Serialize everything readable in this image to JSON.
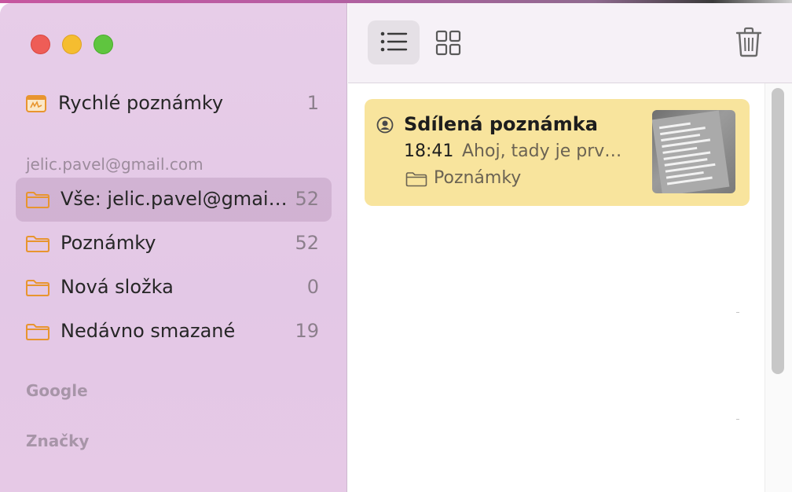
{
  "window": {
    "controls": [
      "close",
      "minimize",
      "zoom"
    ]
  },
  "sidebar": {
    "quick_notes": {
      "label": "Rychlé poznámky",
      "count": "1",
      "icon": "quick-note-icon",
      "color": "#e8952f"
    },
    "account_header": "jelic.pavel@gmail.com",
    "folders": [
      {
        "label": "Vše: jelic.pavel@gmail.com",
        "count": "52",
        "icon": "folder-icon",
        "selected": true
      },
      {
        "label": "Poznámky",
        "count": "52",
        "icon": "folder-icon"
      },
      {
        "label": "Nová složka",
        "count": "0",
        "icon": "folder-icon"
      },
      {
        "label": "Nedávno smazané",
        "count": "19",
        "icon": "folder-icon"
      }
    ],
    "google_header": "Google",
    "tags_header": "Značky",
    "accent": "#e8952f"
  },
  "toolbar": {
    "list_view": {
      "icon": "list-view-icon",
      "active": true
    },
    "gallery_view": {
      "icon": "gallery-view-icon",
      "active": false
    },
    "delete": {
      "icon": "trash-icon"
    }
  },
  "notes": [
    {
      "title": "Sdílená poznámka",
      "time": "18:41",
      "preview": "Ahoj, tady je prv…",
      "folder": "Poznámky",
      "shared": true,
      "has_thumbnail": true,
      "background": "#f8e49d"
    }
  ]
}
